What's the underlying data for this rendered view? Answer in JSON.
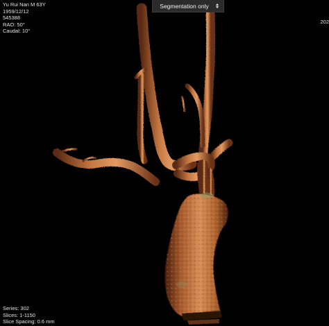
{
  "patient": {
    "name_line": "Yu Rui Nan  M  63Y",
    "dob": "1959/12/12",
    "id": "545388",
    "rao": "RAO: 50°",
    "caudal": "Caudal: 10°"
  },
  "series": {
    "series": "Series: 302",
    "slices": "Slices: 1-1150",
    "spacing": "Slice Spacing: 0.6 mm"
  },
  "corner_top_right": "202",
  "view_mode": {
    "selected": "Segmentation only"
  },
  "colors": {
    "background": "#000000",
    "vessel": "#b8673a",
    "vessel_highlight": "#e8a06a",
    "vessel_shadow": "#5a2a12",
    "dropdown_bg": "#2b2b2b"
  },
  "icons": {
    "dropdown": "chevron-up-down-icon"
  }
}
